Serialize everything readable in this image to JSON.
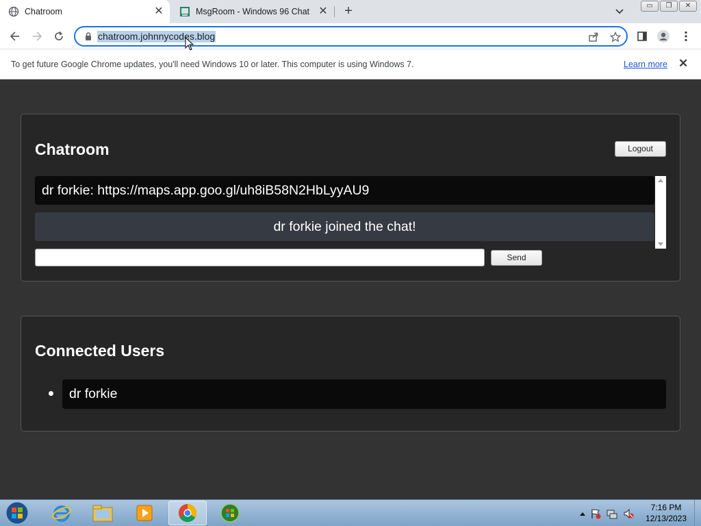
{
  "browser": {
    "tabs": [
      {
        "title": "Chatroom",
        "icon": "globe-icon",
        "active": true
      },
      {
        "title": "MsgRoom - Windows 96 Chat",
        "icon": "msgroom-icon",
        "active": false
      }
    ],
    "address": "chatroom.johnnycodes.blog",
    "window_controls": {
      "minimize": "▭",
      "restore": "❐",
      "close": "✕"
    }
  },
  "infobar": {
    "message": "To get future Google Chrome updates, you'll need Windows 10 or later. This computer is using Windows 7.",
    "link": "Learn more",
    "close": "✕"
  },
  "chatroom": {
    "title": "Chatroom",
    "logout_label": "Logout",
    "messages": [
      {
        "text": "dr forkie: https://maps.app.goo.gl/uh8iB58N2HbLyyAU9",
        "kind": "user"
      },
      {
        "text": "dr forkie joined the chat!",
        "kind": "system"
      }
    ],
    "input_value": "",
    "send_label": "Send"
  },
  "connected_users": {
    "title": "Connected Users",
    "users": [
      "dr forkie"
    ]
  },
  "taskbar": {
    "apps": [
      "internet-explorer",
      "file-explorer",
      "media-player",
      "chrome",
      "windows-media-center"
    ],
    "time": "7:16 PM",
    "date": "12/13/2023"
  },
  "colors": {
    "page_bg": "#333333",
    "panel_bg": "#262626",
    "message_bg": "#0a0a0a",
    "system_message_bg": "#363a42",
    "omnibox_border": "#1a73e8"
  }
}
